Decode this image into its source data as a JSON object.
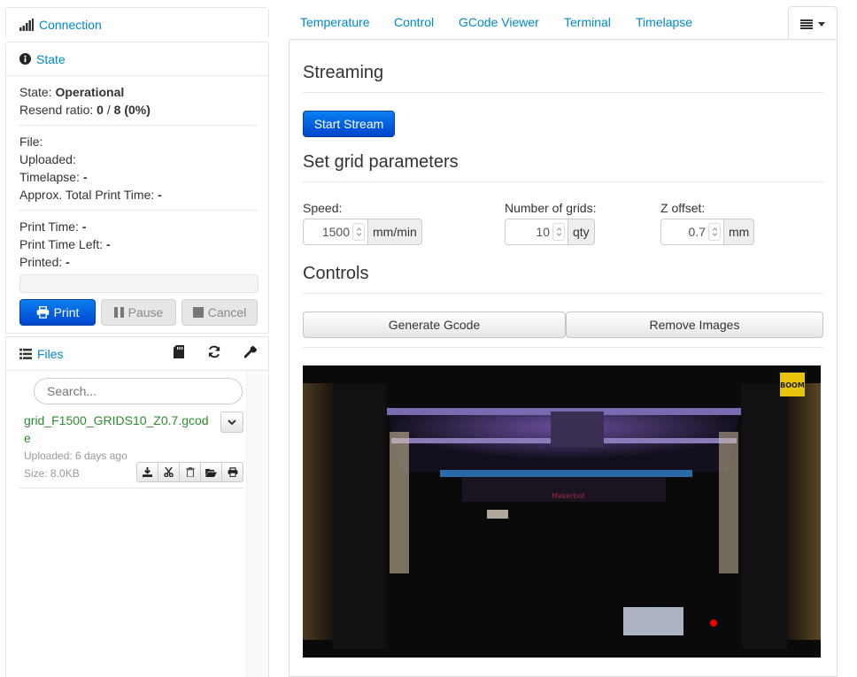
{
  "sidebar": {
    "connection": {
      "title": "Connection"
    },
    "state": {
      "title": "State",
      "state_label": "State:",
      "state_value": "Operational",
      "resend_label": "Resend ratio:",
      "resend_sent": "0",
      "resend_sep": "/",
      "resend_total": "8",
      "resend_pct": "(0%)",
      "file_label": "File:",
      "uploaded_label": "Uploaded:",
      "timelapse_label": "Timelapse:",
      "timelapse_value": "-",
      "approx_label": "Approx. Total Print Time:",
      "approx_value": "-",
      "print_time_label": "Print Time:",
      "print_time_value": "-",
      "print_left_label": "Print Time Left:",
      "print_left_value": "-",
      "printed_label": "Printed:",
      "printed_value": "-",
      "progress": 0,
      "buttons": {
        "print": "Print",
        "pause": "Pause",
        "cancel": "Cancel"
      }
    },
    "files": {
      "title": "Files",
      "search_placeholder": "Search...",
      "items": [
        {
          "name": "grid_F1500_GRIDS10_Z0.7.gcode",
          "uploaded": "Uploaded: 6 days ago",
          "size": "Size: 8.0KB"
        }
      ]
    }
  },
  "tabs": [
    "Temperature",
    "Control",
    "GCode Viewer",
    "Terminal",
    "Timelapse"
  ],
  "main": {
    "streaming_title": "Streaming",
    "start_stream": "Start Stream",
    "grid_title": "Set grid parameters",
    "speed": {
      "label": "Speed:",
      "value": "1500",
      "unit": "mm/min"
    },
    "grids": {
      "label": "Number of grids:",
      "value": "10",
      "unit": "qty"
    },
    "zoffset": {
      "label": "Z offset:",
      "value": "0.7",
      "unit": "mm"
    },
    "controls_title": "Controls",
    "generate_gcode": "Generate Gcode",
    "remove_images": "Remove Images",
    "camera_badge": "BOOM",
    "printer_brand": "Makerbot"
  },
  "colors": {
    "link": "#0088cc",
    "primary": "#0055dd",
    "file_green": "#2e8b2e"
  }
}
